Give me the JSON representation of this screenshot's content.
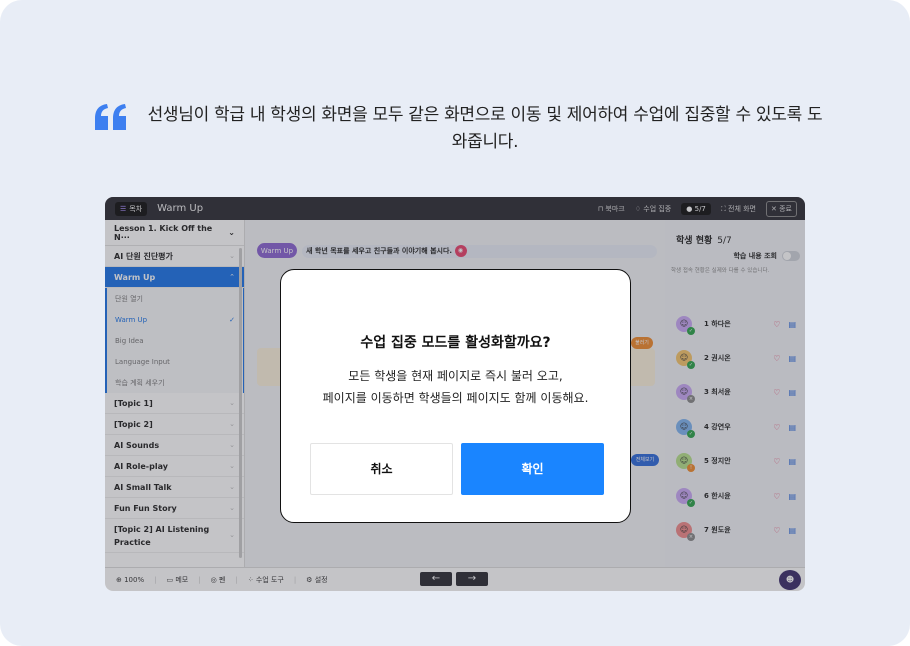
{
  "headline": "선생님이 학급 내 학생의 화면을 모두 같은 화면으로 이동 및 제어하여 수업에 집중할 수 있도록 도와줍니다.",
  "colors": {
    "accent": "#1a85ff",
    "sidebar_active": "#1a73e8",
    "background": "#e8edf6",
    "topbar": "#2b2b33"
  },
  "app": {
    "topbar": {
      "toc_label": "목차",
      "title": "Warm Up",
      "bookmark": "북마크",
      "focus_mode": "수업 집중",
      "student_count": "5/7",
      "fullscreen": "전체 화면",
      "end": "종료"
    },
    "sidebar": {
      "lesson": "Lesson 1. Kick Off the N···",
      "items_before": [
        "AI 단원 진단평가"
      ],
      "active": "Warm Up",
      "sub_items": [
        "단원 열기",
        "Warm Up",
        "Big Idea",
        "Language Input",
        "학습 계획 세우기"
      ],
      "items_after": [
        "[Topic 1]",
        "[Topic 2]",
        "AI Sounds",
        "AI Role-play",
        "AI Small Talk",
        "Fun Fun Story",
        "[Topic 2] AI Listening Practice"
      ]
    },
    "content": {
      "badge": "Warm Up",
      "instruction": "새 학년 목표를 세우고 친구들과 이야기해 봅시다.",
      "orange_pill": "불러기",
      "blue_pill": "전체보기"
    },
    "bottombar": {
      "zoom": "100%",
      "memo": "메모",
      "pen": "펜",
      "tools": "수업 도구",
      "settings": "설정"
    },
    "status": {
      "title": "학생 현황",
      "count": "5/7",
      "view_label": "학습 내용 조회",
      "hint": "학생 접속 현황은 실제와 다를 수 있습니다.",
      "students": [
        "1 하다은",
        "2 권시온",
        "3 최서윤",
        "4 강연우",
        "5 정지안",
        "6 한시윤",
        "7 원도윤"
      ]
    }
  },
  "modal": {
    "title": "수업 집중 모드를 활성화할까요?",
    "body_line1": "모든 학생을 현재 페이지로 즉시 불러 오고,",
    "body_line2": "페이지를 이동하면 학생들의 페이지도 함께 이동해요.",
    "cancel": "취소",
    "confirm": "확인"
  }
}
